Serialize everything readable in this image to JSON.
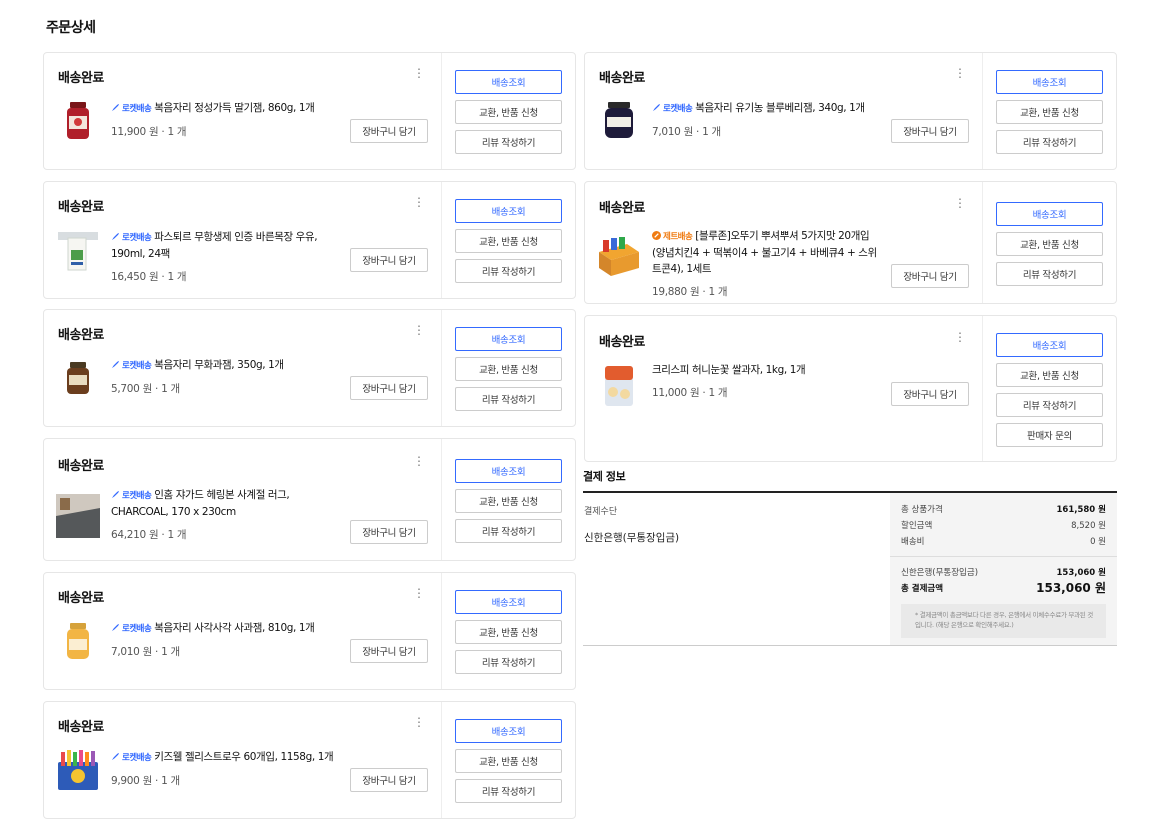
{
  "page_title": "주문상세",
  "buttons": {
    "track": "배송조회",
    "exchange": "교환, 반품 신청",
    "review": "리뷰 작성하기",
    "seller": "판매자 문의",
    "cart": "장바구니 담기"
  },
  "orders": [
    {
      "status": "배송완료",
      "badge": "로켓배송",
      "badge_type": "rocket",
      "title": "복음자리 정성가득 딸기잼, 860g, 1개",
      "price": "11,900 원 · 1 개"
    },
    {
      "status": "배송완료",
      "badge": "로켓배송",
      "badge_type": "rocket",
      "title": "파스퇴르 무항생제 인증 바른목장 우유, 190ml, 24팩",
      "price": "16,450 원 · 1 개"
    },
    {
      "status": "배송완료",
      "badge": "로켓배송",
      "badge_type": "rocket",
      "title": "복음자리 무화과잼, 350g, 1개",
      "price": "5,700 원 · 1 개"
    },
    {
      "status": "배송완료",
      "badge": "로켓배송",
      "badge_type": "rocket",
      "title": "인홈 쟈가드 헤링본 사계절 러그, CHARCOAL, 170 x 230cm",
      "price": "64,210 원 · 1 개"
    },
    {
      "status": "배송완료",
      "badge": "로켓배송",
      "badge_type": "rocket",
      "title": "복음자리 사각사각 사과잼, 810g, 1개",
      "price": "7,010 원 · 1 개"
    },
    {
      "status": "배송완료",
      "badge": "로켓배송",
      "badge_type": "rocket",
      "title": "키즈웰 젤리스트로우 60개입, 1158g, 1개",
      "price": "9,900 원 · 1 개"
    },
    {
      "status": "배송완료",
      "badge": "로켓배송",
      "badge_type": "rocket",
      "title": "복음자리 유기농 블루베리잼, 340g, 1개",
      "price": "7,010 원 · 1 개"
    },
    {
      "status": "배송완료",
      "badge": "제트배송",
      "badge_type": "jet",
      "title": "[블루존]오뚜기 뿌셔뿌셔 5가지맛 20개입 (양념치킨4 + 떡볶이4 + 불고기4 + 바베큐4 + 스위트콘4), 1세트",
      "price": "19,880 원 · 1 개"
    },
    {
      "status": "배송완료",
      "badge": "",
      "badge_type": "none",
      "title": "크리스피 허니눈꽃 쌀과자, 1kg, 1개",
      "price": "11,000 원 · 1 개"
    }
  ],
  "payment": {
    "title": "결제 정보",
    "method_label": "결제수단",
    "method_value": "신한은행(무통장입금)",
    "rows": [
      {
        "label": "총 상품가격",
        "value": "161,580 원"
      },
      {
        "label": "할인금액",
        "value": "8,520 원"
      },
      {
        "label": "배송비",
        "value": "0 원"
      }
    ],
    "bank_label": "신한은행(무통장입금)",
    "bank_value": "153,060 원",
    "total_label": "총 결제금액",
    "total_value": "153,060 원",
    "note": "* 결제금액이 총금액보다 다른 경우, 은행에서 이체수수료가 부과된 것 입니다. (해당 은행으로 확인해주세요.)"
  },
  "colors": {
    "accent": "#346aff",
    "jet": "#f07c12"
  },
  "icons": {
    "rocket": "rocket-icon",
    "jet": "jet-icon",
    "more": "kebab-icon"
  }
}
